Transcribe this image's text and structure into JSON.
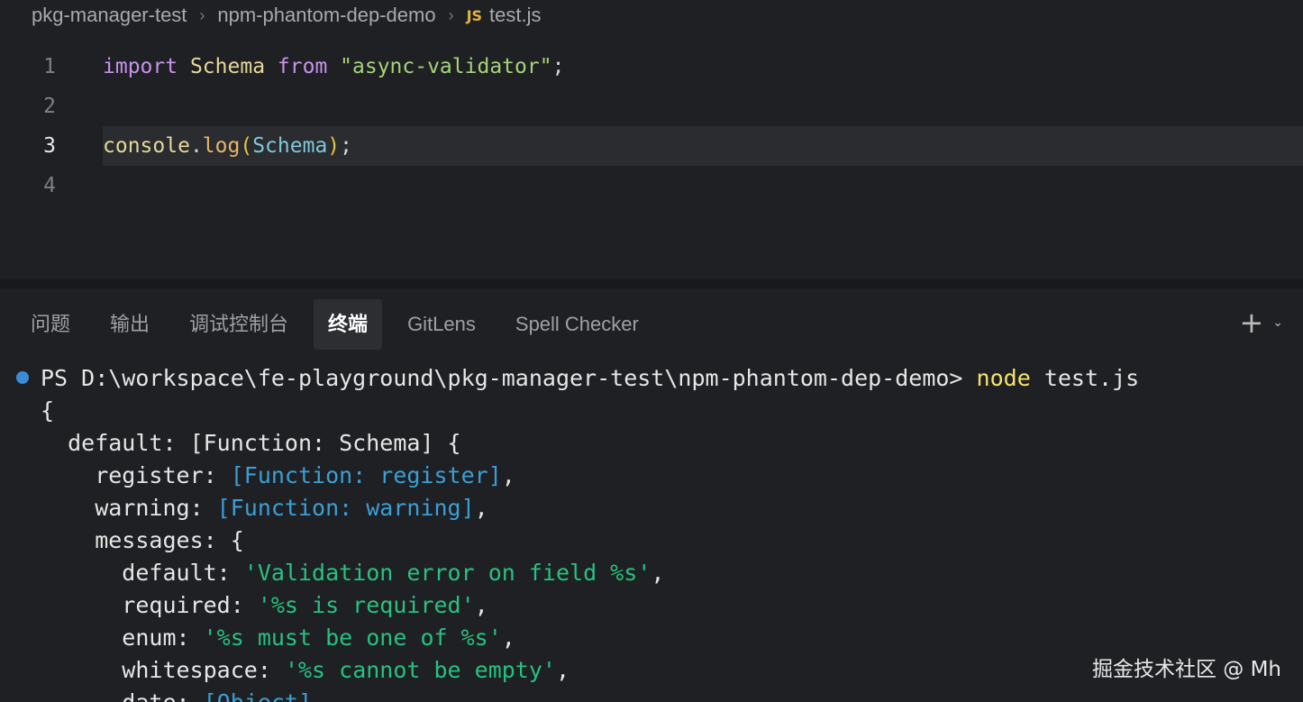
{
  "breadcrumb": {
    "items": [
      "pkg-manager-test",
      "npm-phantom-dep-demo",
      "test.js"
    ],
    "file_badge": "JS"
  },
  "editor": {
    "line_numbers": [
      "1",
      "2",
      "3",
      "4"
    ],
    "active_line": 3,
    "lines": [
      {
        "tokens": [
          {
            "t": "import",
            "c": "kw"
          },
          {
            "t": " ",
            "c": "punct"
          },
          {
            "t": "Schema",
            "c": "ident"
          },
          {
            "t": " ",
            "c": "punct"
          },
          {
            "t": "from",
            "c": "kw"
          },
          {
            "t": " ",
            "c": "punct"
          },
          {
            "t": "\"async-validator\"",
            "c": "str"
          },
          {
            "t": ";",
            "c": "punct"
          }
        ]
      },
      {
        "tokens": []
      },
      {
        "tokens": [
          {
            "t": "console",
            "c": "obj"
          },
          {
            "t": ".",
            "c": "punct"
          },
          {
            "t": "log",
            "c": "method"
          },
          {
            "t": "(",
            "c": "paren"
          },
          {
            "t": "Schema",
            "c": "param"
          },
          {
            "t": ")",
            "c": "paren"
          },
          {
            "t": ";",
            "c": "punct"
          }
        ]
      },
      {
        "tokens": []
      }
    ]
  },
  "panel": {
    "tabs": [
      {
        "label": "问题",
        "active": false
      },
      {
        "label": "输出",
        "active": false
      },
      {
        "label": "调试控制台",
        "active": false
      },
      {
        "label": "终端",
        "active": true
      },
      {
        "label": "GitLens",
        "active": false
      },
      {
        "label": "Spell Checker",
        "active": false
      }
    ],
    "actions": {
      "add_icon": "plus-icon",
      "dropdown_icon": "chevron-down-icon"
    }
  },
  "terminal": {
    "status_color": "#3b8bd6",
    "lines": [
      {
        "tokens": [
          {
            "t": "PS D:\\workspace\\fe-playground\\pkg-manager-test\\npm-phantom-dep-demo> ",
            "c": ""
          },
          {
            "t": "node",
            "c": "cmd"
          },
          {
            "t": " test.js",
            "c": ""
          }
        ]
      },
      {
        "tokens": [
          {
            "t": "{",
            "c": ""
          }
        ]
      },
      {
        "tokens": [
          {
            "t": "  default: [Function: Schema] {",
            "c": ""
          }
        ]
      },
      {
        "tokens": [
          {
            "t": "    register: ",
            "c": ""
          },
          {
            "t": "[Function: register]",
            "c": "fn"
          },
          {
            "t": ",",
            "c": ""
          }
        ]
      },
      {
        "tokens": [
          {
            "t": "    warning: ",
            "c": ""
          },
          {
            "t": "[Function: warning]",
            "c": "fn"
          },
          {
            "t": ",",
            "c": ""
          }
        ]
      },
      {
        "tokens": [
          {
            "t": "    messages: {",
            "c": ""
          }
        ]
      },
      {
        "tokens": [
          {
            "t": "      default: ",
            "c": ""
          },
          {
            "t": "'Validation error on field %s'",
            "c": "sq"
          },
          {
            "t": ",",
            "c": ""
          }
        ]
      },
      {
        "tokens": [
          {
            "t": "      required: ",
            "c": ""
          },
          {
            "t": "'%s is required'",
            "c": "sq"
          },
          {
            "t": ",",
            "c": ""
          }
        ]
      },
      {
        "tokens": [
          {
            "t": "      enum: ",
            "c": ""
          },
          {
            "t": "'%s must be one of %s'",
            "c": "sq"
          },
          {
            "t": ",",
            "c": ""
          }
        ]
      },
      {
        "tokens": [
          {
            "t": "      whitespace: ",
            "c": ""
          },
          {
            "t": "'%s cannot be empty'",
            "c": "sq"
          },
          {
            "t": ",",
            "c": ""
          }
        ]
      },
      {
        "tokens": [
          {
            "t": "      date: ",
            "c": ""
          },
          {
            "t": "[Object]",
            "c": "fn"
          },
          {
            "t": ",",
            "c": ""
          }
        ]
      }
    ]
  },
  "watermark": "掘金技术社区 @ Mh"
}
